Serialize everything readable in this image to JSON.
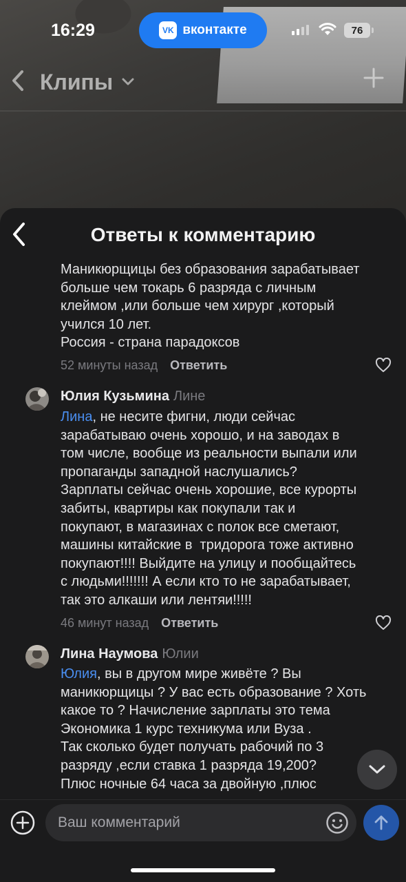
{
  "status_bar": {
    "time": "16:29",
    "app_pill": "вконтакте",
    "app_logo": "VK",
    "battery": "76"
  },
  "clips_header": {
    "title": "Клипы"
  },
  "sheet": {
    "title": "Ответы к комментарию"
  },
  "comments": [
    {
      "text": "Маникюрщицы без образования зарабатывает\nбольше чем токарь 6 разряда с личным\nклеймом ,или больше чем хирург ,который\nучился 10 лет.\nРоссия - страна парадоксов",
      "time": "52 минуты назад",
      "reply": "Ответить"
    },
    {
      "author": "Юлия Кузьмина",
      "to": "Лине",
      "mention": "Лина",
      "text": ", не несите фигни, люди сейчас\nзарабатываю очень хорошо, и на заводах в\nтом числе, вообще из реальности выпали или\nпропаганды западной наслушались?\nЗарплаты сейчас очень хорошие, все курорты\nзабиты, квартиры как покупали так и\nпокупают, в магазинах с полок все сметают,\nмашины китайские в  тридорога тоже активно\nпокупают!!!! Выйдите на улицу и пообщайтесь\nс людьми!!!!!!! А если кто то не зарабатывает,\nтак это алкаши или лентяи!!!!!",
      "time": "46 минут назад",
      "reply": "Ответить"
    },
    {
      "author": "Лина Наумова",
      "to": "Юлии",
      "mention": "Юлия",
      "text": ", вы в другом мире живёте ? Вы\nманикюрщицы ? У вас есть образование ? Хоть\nкакое то ? Начисление зарплаты это тема\nЭкономика 1 курс техникума или Вуза .\nТак сколько будет получать рабочий по 3\nразряду ,если ставка 1 разряда 19,200?\nПлюс ночные 64 часа за двойную ,плюс"
    }
  ],
  "input": {
    "placeholder": "Ваш комментарий"
  },
  "colors": {
    "accent": "#1f7bf2",
    "mention": "#4a8ef0",
    "send": "#2456a8",
    "background": "#1b1b1c"
  },
  "icons": [
    "back-chevron-icon",
    "chevron-down-icon",
    "plus-icon",
    "heart-icon",
    "add-circle-icon",
    "emoji-icon",
    "send-arrow-icon",
    "scroll-down-icon"
  ]
}
